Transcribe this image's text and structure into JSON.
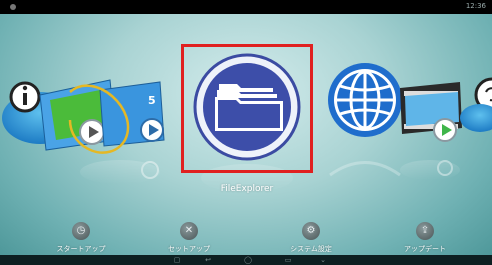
{
  "status": {
    "time": "12:36"
  },
  "carousel": {
    "selected_app_label": "FileExplorer",
    "apps": [
      {
        "name": "info"
      },
      {
        "name": "video-player"
      },
      {
        "name": "file-explorer"
      },
      {
        "name": "web-browser"
      },
      {
        "name": "movie-player"
      },
      {
        "name": "partial-next"
      }
    ]
  },
  "dock": {
    "items": [
      {
        "label": "スタートアップ",
        "icon": "clock-icon"
      },
      {
        "label": "セットアップ",
        "icon": "tools-icon"
      },
      {
        "label": "システム設定",
        "icon": "gear-icon"
      },
      {
        "label": "アップデート",
        "icon": "update-icon"
      }
    ]
  },
  "colors": {
    "selection_frame": "#e02020",
    "folder_blue": "#3f4fa8",
    "film_blue": "#2d8fd8"
  }
}
